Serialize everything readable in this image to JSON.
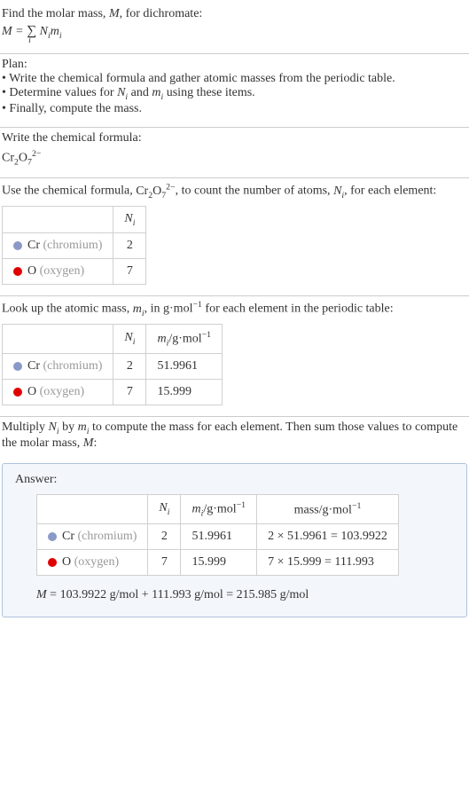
{
  "intro": {
    "line1": "Find the molar mass, ",
    "line1_var": "M",
    "line1_end": ", for dichromate:",
    "formula_lhs": "M",
    "formula_eq": " = ",
    "formula_rhs_pre": "∑",
    "formula_rhs_sub": "i",
    "formula_rhs_N": " N",
    "formula_rhs_Nsub": "i",
    "formula_rhs_m": "m",
    "formula_rhs_msub": "i"
  },
  "plan": {
    "header": "Plan:",
    "item1": "• Write the chemical formula and gather atomic masses from the periodic table.",
    "item2_pre": "• Determine values for ",
    "item2_N": "N",
    "item2_Nsub": "i",
    "item2_mid": " and ",
    "item2_m": "m",
    "item2_msub": "i",
    "item2_end": " using these items.",
    "item3": "• Finally, compute the mass."
  },
  "write_formula": {
    "header": "Write the chemical formula:",
    "cr": "Cr",
    "cr_sub": "2",
    "o": "O",
    "o_sub": "7",
    "charge": "2−"
  },
  "count": {
    "pre": "Use the chemical formula, ",
    "cr": "Cr",
    "cr_sub": "2",
    "o": "O",
    "o_sub": "7",
    "charge": "2−",
    "mid": ", to count the number of atoms, ",
    "N": "N",
    "Nsub": "i",
    "end": ", for each element:",
    "header_N": "N",
    "header_Nsub": "i",
    "cr_label": "Cr",
    "cr_name": " (chromium)",
    "cr_count": "2",
    "o_label": "O",
    "o_name": " (oxygen)",
    "o_count": "7"
  },
  "lookup": {
    "pre": "Look up the atomic mass, ",
    "m": "m",
    "msub": "i",
    "mid": ", in g·mol",
    "exp": "−1",
    "end": " for each element in the periodic table:",
    "header_N": "N",
    "header_Nsub": "i",
    "header_m": "m",
    "header_msub": "i",
    "header_unit": "/g·mol",
    "header_exp": "−1",
    "cr_label": "Cr",
    "cr_name": " (chromium)",
    "cr_count": "2",
    "cr_mass": "51.9961",
    "o_label": "O",
    "o_name": " (oxygen)",
    "o_count": "7",
    "o_mass": "15.999"
  },
  "multiply": {
    "pre": "Multiply ",
    "N": "N",
    "Nsub": "i",
    "mid": " by ",
    "m": "m",
    "msub": "i",
    "mid2": " to compute the mass for each element. Then sum those values to compute the molar mass, ",
    "M": "M",
    "end": ":"
  },
  "answer": {
    "label": "Answer:",
    "header_N": "N",
    "header_Nsub": "i",
    "header_m": "m",
    "header_msub": "i",
    "header_m_unit": "/g·mol",
    "header_m_exp": "−1",
    "header_mass": "mass/g·mol",
    "header_mass_exp": "−1",
    "cr_label": "Cr",
    "cr_name": " (chromium)",
    "cr_count": "2",
    "cr_mass": "51.9961",
    "cr_calc": "2 × 51.9961 = 103.9922",
    "o_label": "O",
    "o_name": " (oxygen)",
    "o_count": "7",
    "o_mass": "15.999",
    "o_calc": "7 × 15.999 = 111.993",
    "result_M": "M",
    "result_eq": " = 103.9922 g/mol + 111.993 g/mol = 215.985 g/mol"
  },
  "chart_data": {
    "type": "table",
    "title": "Molar mass calculation for dichromate Cr2O7^2-",
    "elements": [
      {
        "symbol": "Cr",
        "name": "chromium",
        "N_i": 2,
        "m_i_g_per_mol": 51.9961,
        "mass_g_per_mol": 103.9922
      },
      {
        "symbol": "O",
        "name": "oxygen",
        "N_i": 7,
        "m_i_g_per_mol": 15.999,
        "mass_g_per_mol": 111.993
      }
    ],
    "molar_mass_g_per_mol": 215.985
  }
}
